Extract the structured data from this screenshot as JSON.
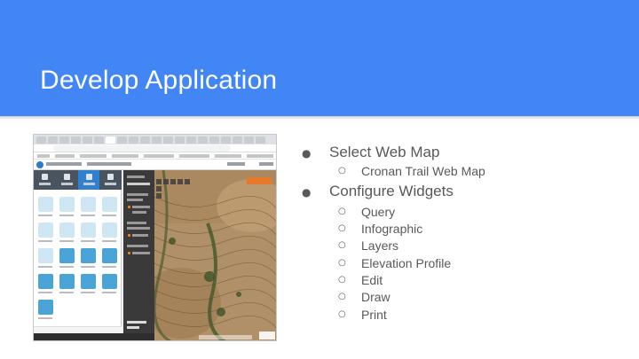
{
  "slide": {
    "title": "Develop Application",
    "header_color": "#4285f4"
  },
  "bullets": [
    {
      "label": "Select Web Map",
      "marker": "●",
      "children": [
        {
          "label": "Cronan Trail Web Map",
          "marker": "○"
        }
      ]
    },
    {
      "label": "Configure Widgets",
      "marker": "●",
      "children": [
        {
          "label": "Query",
          "marker": "○"
        },
        {
          "label": "Infographic",
          "marker": "○"
        },
        {
          "label": "Layers",
          "marker": "○"
        },
        {
          "label": "Elevation Profile",
          "marker": "○"
        },
        {
          "label": "Edit",
          "marker": "○"
        },
        {
          "label": "Draw",
          "marker": "○"
        },
        {
          "label": "Print",
          "marker": "○"
        }
      ]
    }
  ],
  "screenshot": {
    "icons": {
      "browser": "browser-window",
      "app_logo": "web-appbuilder-logo",
      "panel_tabs": [
        "theme-icon",
        "map-icon",
        "widget-icon",
        "attribute-icon"
      ]
    },
    "colors": {
      "active_tab": "#2f80ce",
      "widget_on": "#4aa4d8",
      "widget_off": "#cfe6f5",
      "panel_dark": "#3a3a3a",
      "accent": "#e07a1f"
    }
  }
}
